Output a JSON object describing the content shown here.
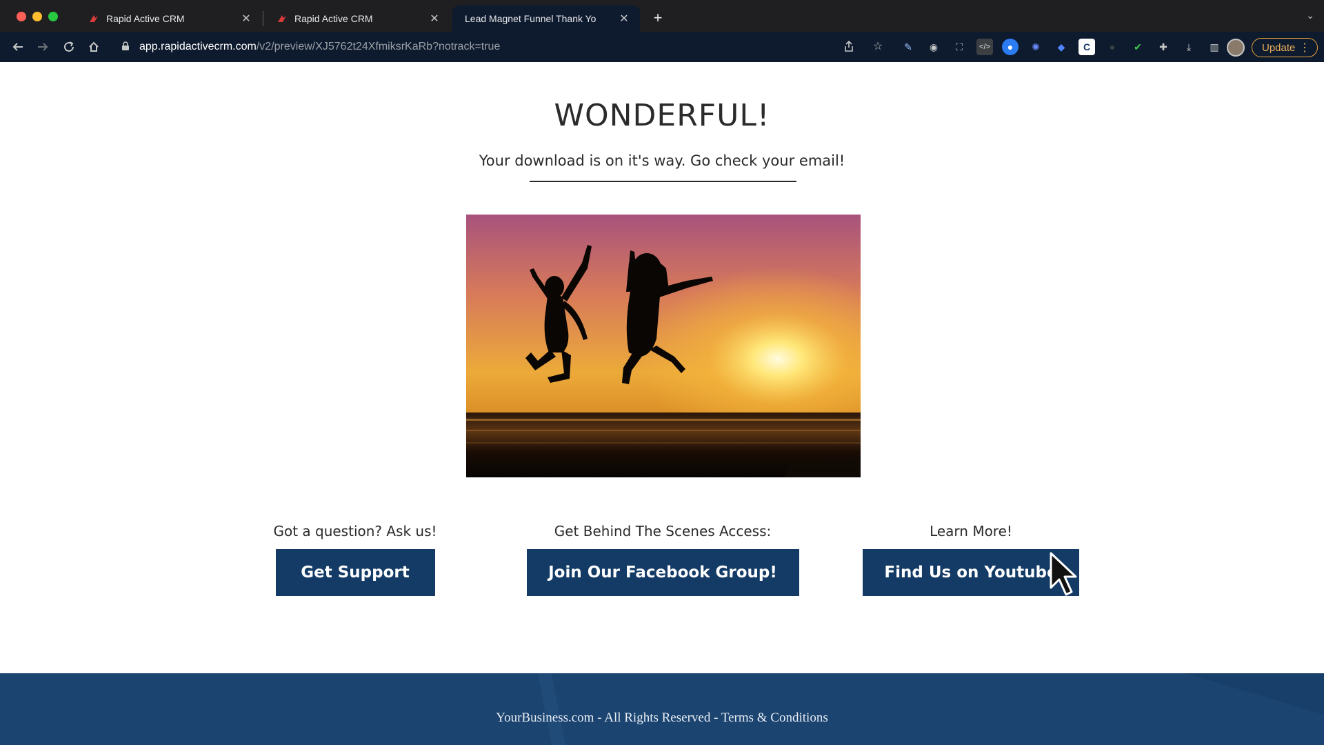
{
  "browser": {
    "tabs": [
      {
        "title": "Rapid Active CRM"
      },
      {
        "title": "Rapid Active CRM"
      },
      {
        "title": "Lead Magnet Funnel Thank Yo",
        "active": true
      }
    ],
    "url_host": "app.rapidactivecrm.com",
    "url_path": "/v2/preview/XJ5762t24XfmiksrKaRb?notrack=true",
    "update_label": "Update",
    "icons": {
      "back": "back-arrow-icon",
      "forward": "forward-arrow-icon",
      "reload": "reload-icon",
      "home": "home-icon",
      "lock": "lock-icon",
      "share": "share-icon",
      "bookmark": "star-icon"
    }
  },
  "page": {
    "headline": "WONDERFUL!",
    "subline": "Your download is on it's way. Go check your email!",
    "hero_image": "sunset-silhouette-jumping-image",
    "columns": [
      {
        "label": "Got a question? Ask us!",
        "button": "Get Support"
      },
      {
        "label": "Get Behind The Scenes Access:",
        "button": "Join Our Facebook Group!"
      },
      {
        "label": "Learn More!",
        "button": "Find Us on Youtube"
      }
    ],
    "footer_text": "YourBusiness.com - All Rights Reserved - Terms & Conditions"
  },
  "colors": {
    "button_bg": "#133b66",
    "footer_bg": "#1b4470",
    "update_accent": "#e8a33a"
  }
}
